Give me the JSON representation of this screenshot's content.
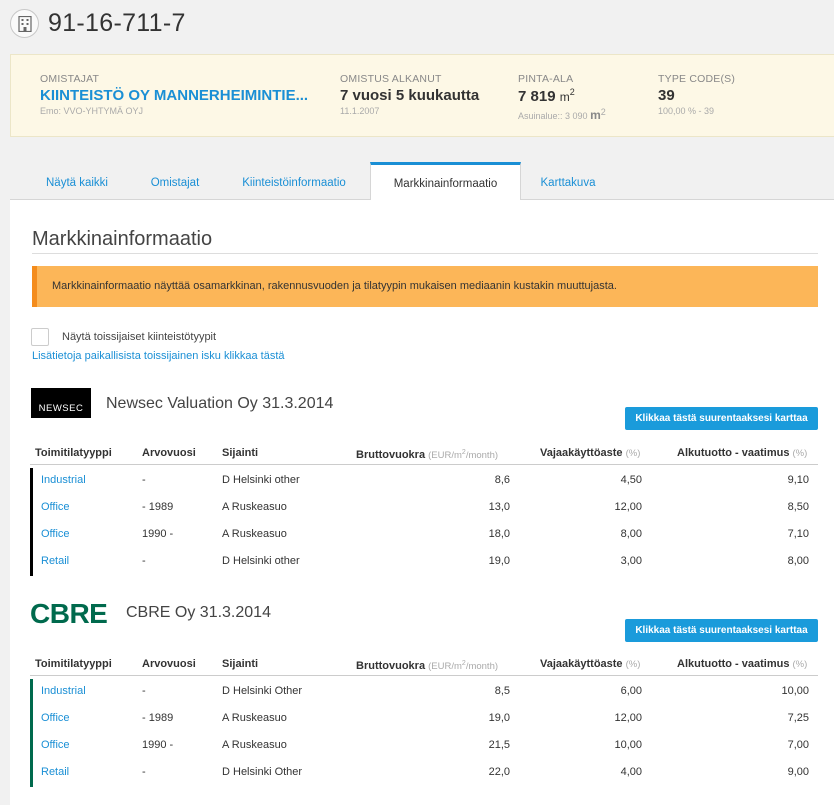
{
  "header": {
    "title": "91-16-711-7",
    "icon": "building-icon"
  },
  "summary": {
    "owners": {
      "label": "OMISTAJAT",
      "value": "KIINTEISTÖ OY MANNERHEIMINTIE...",
      "sub": "Emo: VVO-YHTYMÄ OYJ"
    },
    "ownership": {
      "label": "OMISTUS ALKANUT",
      "value": "7 vuosi 5 kuukautta",
      "sub": "11.1.2007"
    },
    "area": {
      "label": "PINTA-ALA",
      "value": "7 819",
      "unit": "m",
      "unit_sup": "2",
      "sub": "Asuinalue:: 3 090",
      "sub_unit": "m",
      "sub_sup": "2"
    },
    "type_code": {
      "label": "TYPE CODE(S)",
      "value": "39",
      "sub": "100,00 % - 39"
    }
  },
  "tabs": [
    {
      "label": "Näytä kaikki",
      "active": false
    },
    {
      "label": "Omistajat",
      "active": false
    },
    {
      "label": "Kiinteistöinformaatio",
      "active": false
    },
    {
      "label": "Markkinainformaatio",
      "active": true
    },
    {
      "label": "Karttakuva",
      "active": false
    }
  ],
  "section": {
    "title": "Markkinainformaatio",
    "notice": "Markkinainformaatio näyttää osamarkkinan, rakennusvuoden ja tilatyypin mukaisen mediaanin kustakin muuttujasta.",
    "checkbox_label": "Näytä toissijaiset kiinteistötyypit",
    "checkbox_checked": false,
    "link": "Lisätietoja paikallisista toissijainen isku klikkaa tästä"
  },
  "columns": {
    "type": "Toimitilatyyppi",
    "year": "Arvovuosi",
    "location": "Sijainti",
    "rent": "Bruttovuokra",
    "rent_unit_pre": "(EUR/m",
    "rent_unit_sup": "2",
    "rent_unit_post": "/month)",
    "vacancy": "Vajaakäyttöaste",
    "vacancy_unit": "(%)",
    "yield": "Alkutuotto - vaatimus",
    "yield_unit": "(%)"
  },
  "colors": {
    "accent": "#1a8fd5",
    "newsec_rail": "#000000",
    "cbre_rail": "#006a4d",
    "notice_bg": "#fcb658"
  },
  "providers": [
    {
      "logo_text": "NEWSEC",
      "name": "Newsec Valuation Oy 31.3.2014",
      "map_button": "Klikkaa tästä suurentaaksesi karttaa",
      "rows": [
        {
          "type": "Industrial",
          "year": "-",
          "location": "D Helsinki other",
          "rent": "8,6",
          "vacancy": "4,50",
          "yield": "9,10"
        },
        {
          "type": "Office",
          "year": "- 1989",
          "location": "A Ruskeasuo",
          "rent": "13,0",
          "vacancy": "12,00",
          "yield": "8,50"
        },
        {
          "type": "Office",
          "year": "1990 -",
          "location": "A Ruskeasuo",
          "rent": "18,0",
          "vacancy": "8,00",
          "yield": "7,10"
        },
        {
          "type": "Retail",
          "year": "-",
          "location": "D Helsinki other",
          "rent": "19,0",
          "vacancy": "3,00",
          "yield": "8,00"
        }
      ]
    },
    {
      "logo_text": "CBRE",
      "name": "CBRE Oy 31.3.2014",
      "map_button": "Klikkaa tästä suurentaaksesi karttaa",
      "rows": [
        {
          "type": "Industrial",
          "year": "-",
          "location": "D Helsinki Other",
          "rent": "8,5",
          "vacancy": "6,00",
          "yield": "10,00"
        },
        {
          "type": "Office",
          "year": "- 1989",
          "location": "A Ruskeasuo",
          "rent": "19,0",
          "vacancy": "12,00",
          "yield": "7,25"
        },
        {
          "type": "Office",
          "year": "1990 -",
          "location": "A Ruskeasuo",
          "rent": "21,5",
          "vacancy": "10,00",
          "yield": "7,00"
        },
        {
          "type": "Retail",
          "year": "-",
          "location": "D Helsinki Other",
          "rent": "22,0",
          "vacancy": "4,00",
          "yield": "9,00"
        }
      ]
    }
  ]
}
